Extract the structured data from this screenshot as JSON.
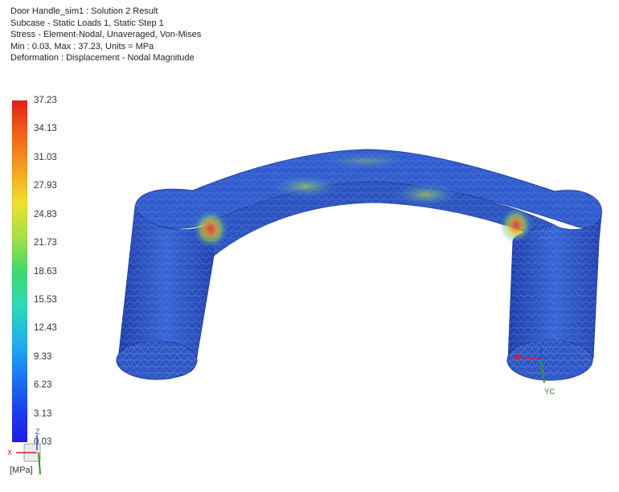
{
  "header": {
    "line1": "Door Handle_sim1 : Solution 2 Result",
    "line2": "Subcase - Static Loads 1, Static Step 1",
    "line3": "Stress - Element-Nodal, Unaveraged, Von-Mises",
    "line4": "Min : 0.03, Max : 37.23, Units = MPa",
    "line5": "Deformation : Displacement - Nodal Magnitude"
  },
  "legend": {
    "ticks": [
      "37.23",
      "34.13",
      "31.03",
      "27.93",
      "24.83",
      "21.73",
      "18.63",
      "15.53",
      "12.43",
      "9.33",
      "6.23",
      "3.13",
      "0.03"
    ],
    "unit": "[MPa]",
    "min": 0.03,
    "max": 37.23
  },
  "triad": {
    "model_label": "YC",
    "mini_z": "Z",
    "mini_x": "X"
  },
  "colors": {
    "mesh_base": "#2b50c8",
    "mesh_edge": "#2e3f8f",
    "hotspot": "#e8432a",
    "axis_x": "#d62020",
    "axis_y": "#2a9a2a",
    "axis_z": "#2040d0"
  }
}
